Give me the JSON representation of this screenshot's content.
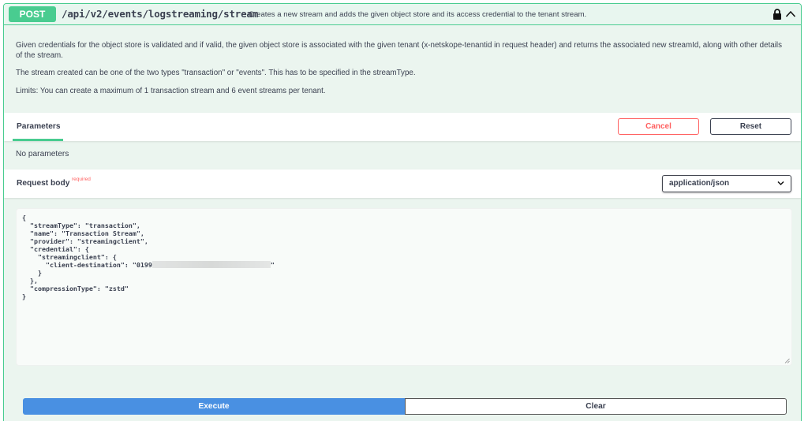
{
  "operation": {
    "method": "POST",
    "path": "/api/v2/events/logstreaming/stream",
    "summary": "Creates a new stream and adds the given object store and its access credential to the tenant stream."
  },
  "description": {
    "p1": "Given credentials for the object store is validated and if valid, the given object store is associated with the given tenant (x-netskope-tenantid in request header) and returns the associated new streamId, along with other details of the stream.",
    "p2": "The stream created can be one of the two types \"transaction\" or \"events\". This has to be specified in the streamType.",
    "p3": "Limits: You can create a maximum of 1 transaction stream and 6 event streams per tenant."
  },
  "parameters": {
    "tab_label": "Parameters",
    "cancel_label": "Cancel",
    "reset_label": "Reset",
    "empty_text": "No parameters"
  },
  "request_body": {
    "title": "Request body",
    "required_label": "required",
    "content_type": "application/json",
    "lines": [
      "{",
      "  \"streamType\": \"transaction\",",
      "  \"name\": \"Transaction Stream\",",
      "  \"provider\": \"streamingclient\",",
      "  \"credential\": {",
      "    \"streamingclient\": {",
      "      \"client-destination\": \"0199",
      "\"",
      "    }",
      "  },",
      "  \"compressionType\": \"zstd\"",
      "}"
    ]
  },
  "actions": {
    "execute_label": "Execute",
    "clear_label": "Clear"
  },
  "colors": {
    "post_accent": "#49cc90",
    "execute_blue": "#4990e2",
    "cancel_red": "#ff6060"
  },
  "icons": {
    "lock": "lock-icon",
    "collapse": "chevron-up-icon",
    "dropdown": "chevron-down-icon"
  }
}
